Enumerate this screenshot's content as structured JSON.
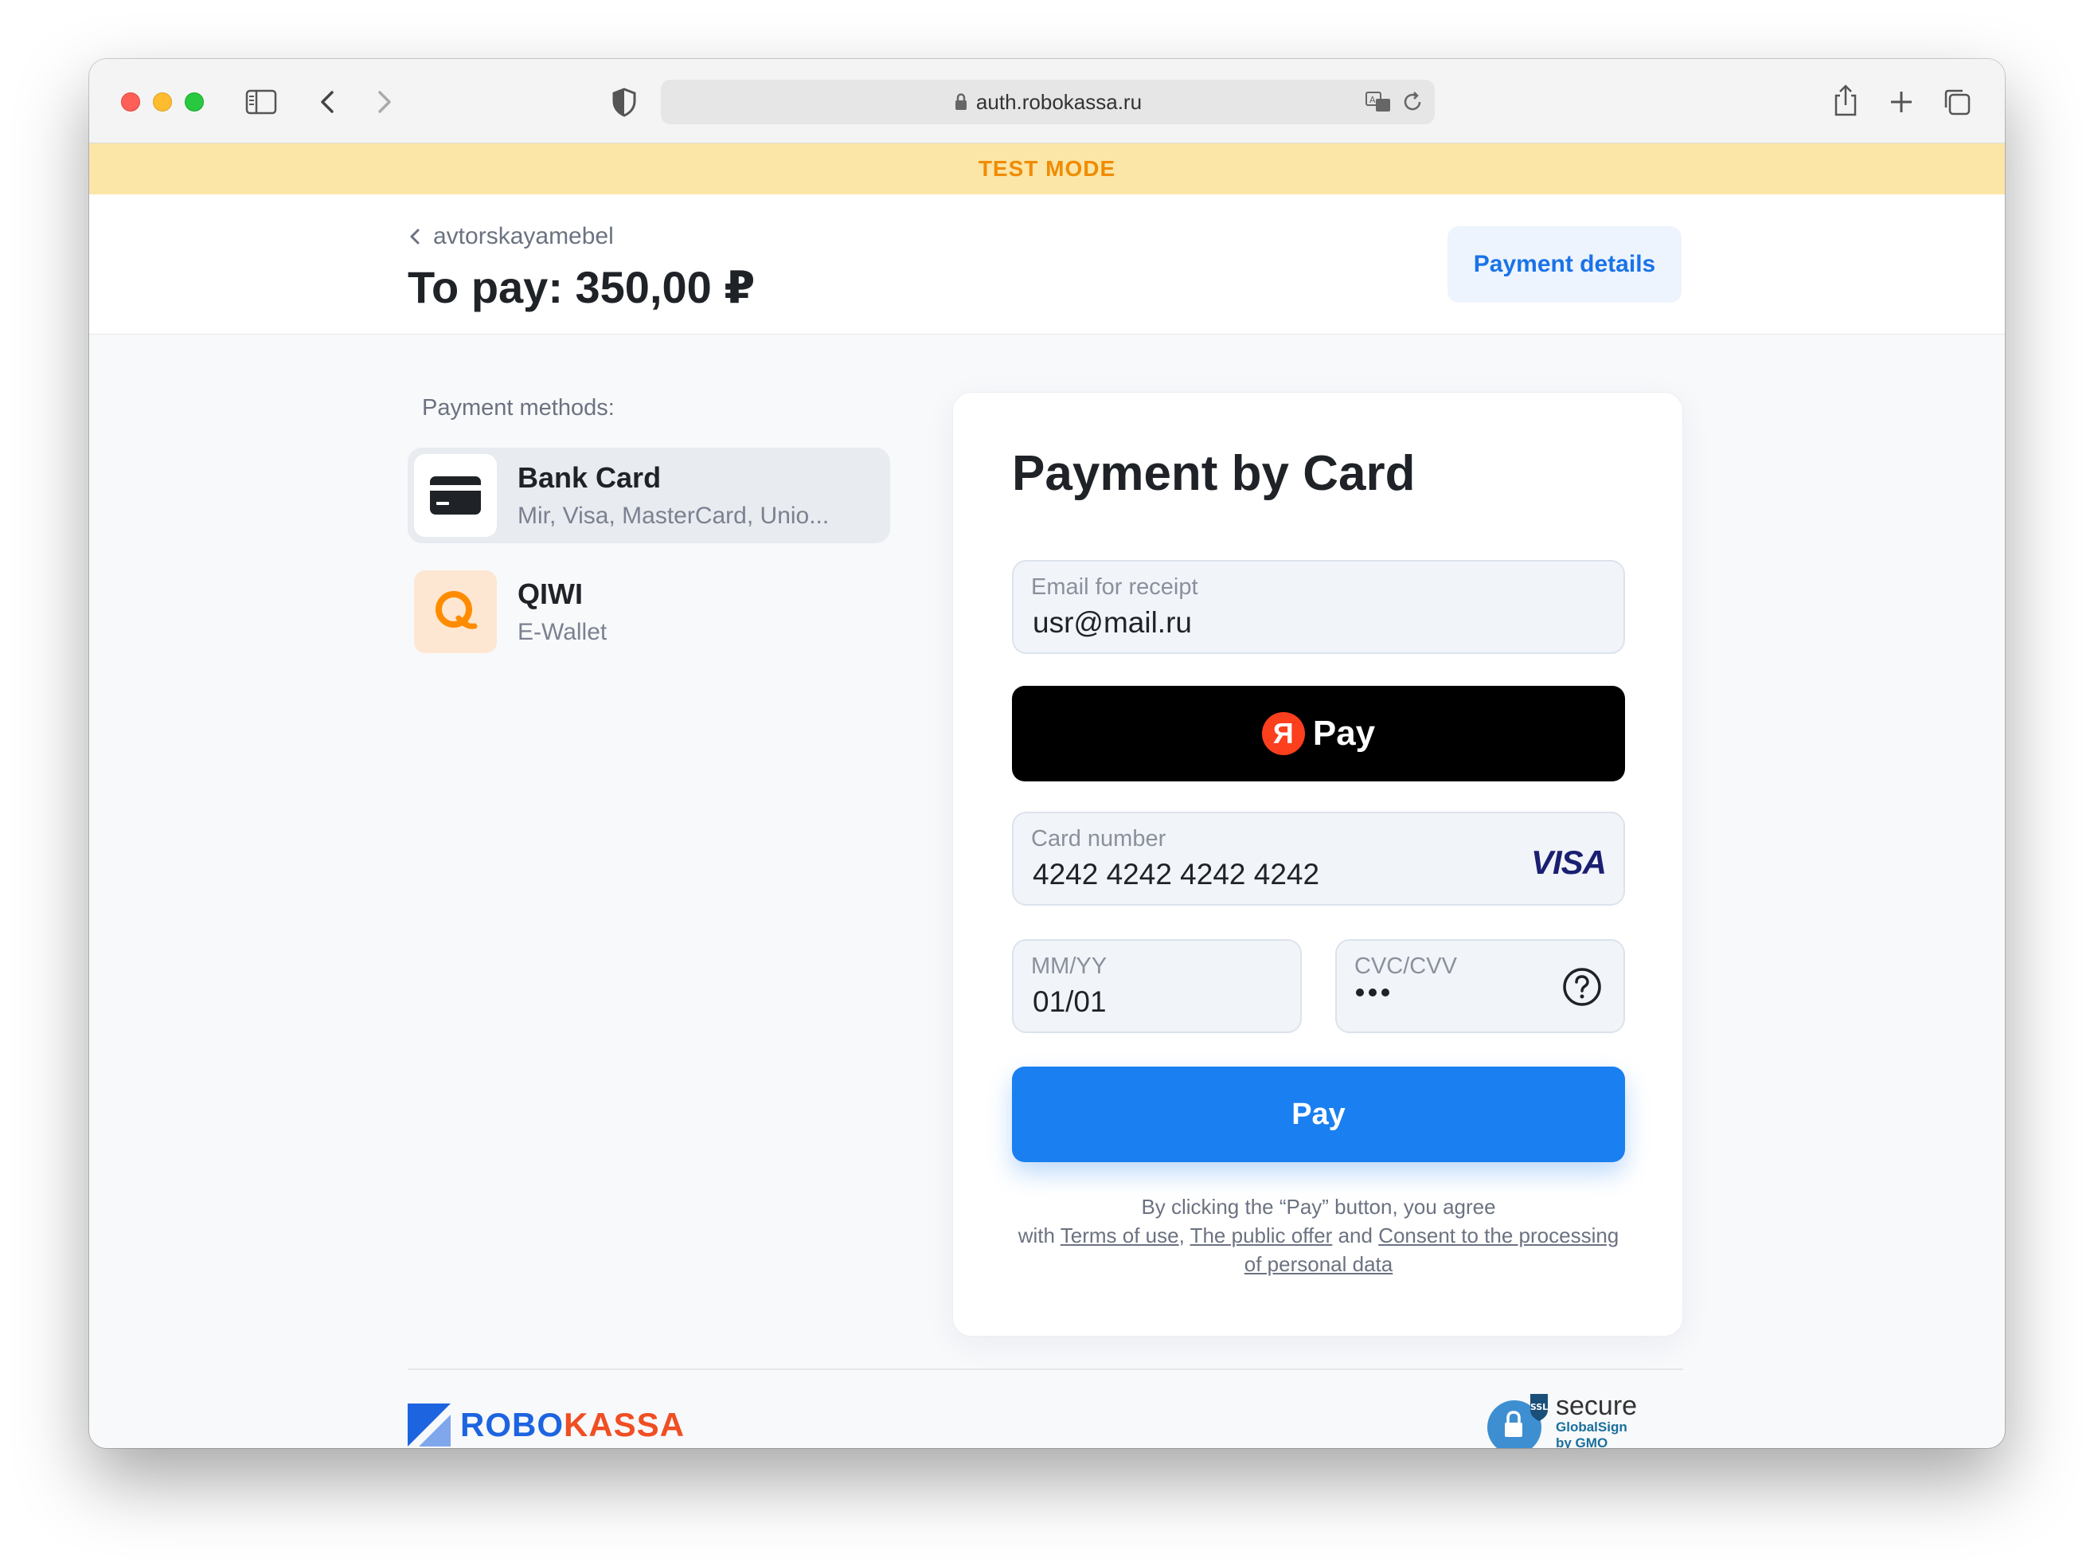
{
  "browser": {
    "url": "auth.robokassa.ru"
  },
  "banner": {
    "text": "TEST MODE"
  },
  "header": {
    "merchant": "avtorskayamebel",
    "to_pay": "To pay: 350,00 ₽",
    "details_button": "Payment details"
  },
  "methods": {
    "label": "Payment methods:",
    "items": [
      {
        "title": "Bank Card",
        "subtitle": "Mir, Visa, MasterCard, Unio...",
        "icon": "credit-card-icon",
        "active": true
      },
      {
        "title": "QIWI",
        "subtitle": "E-Wallet",
        "icon": "qiwi-icon",
        "active": false
      }
    ]
  },
  "card_form": {
    "title": "Payment by Card",
    "email": {
      "label": "Email for receipt",
      "value": "usr@mail.ru"
    },
    "yandex_pay": {
      "badge": "Я",
      "label": "Pay"
    },
    "card_number": {
      "label": "Card number",
      "value": "4242 4242 4242 4242",
      "brand": "VISA"
    },
    "expiry": {
      "label": "MM/YY",
      "value": "01/01"
    },
    "cvc": {
      "label": "CVC/CVV"
    },
    "pay_button": "Pay",
    "agreement": {
      "line1": "By clicking the “Pay” button, you agree",
      "with": "with",
      "terms": "Terms of use",
      "comma": ",",
      "offer": "The public offer",
      "and": "and",
      "consent": "Consent to the processing of personal data"
    }
  },
  "footer": {
    "logo_part1": "ROBO",
    "logo_part2": "KASSA",
    "ssl_badge": "SSL",
    "ssl_secure": "secure",
    "ssl_issuer": "GlobalSign",
    "ssl_by": "by GMO"
  },
  "colors": {
    "accent": "#1a7ff0",
    "test_banner_bg": "#fbe6a8",
    "test_banner_text": "#f08c00",
    "yandex_red": "#fc3f1d",
    "qiwi_orange": "#ff8c00",
    "visa_navy": "#1a1f71"
  }
}
